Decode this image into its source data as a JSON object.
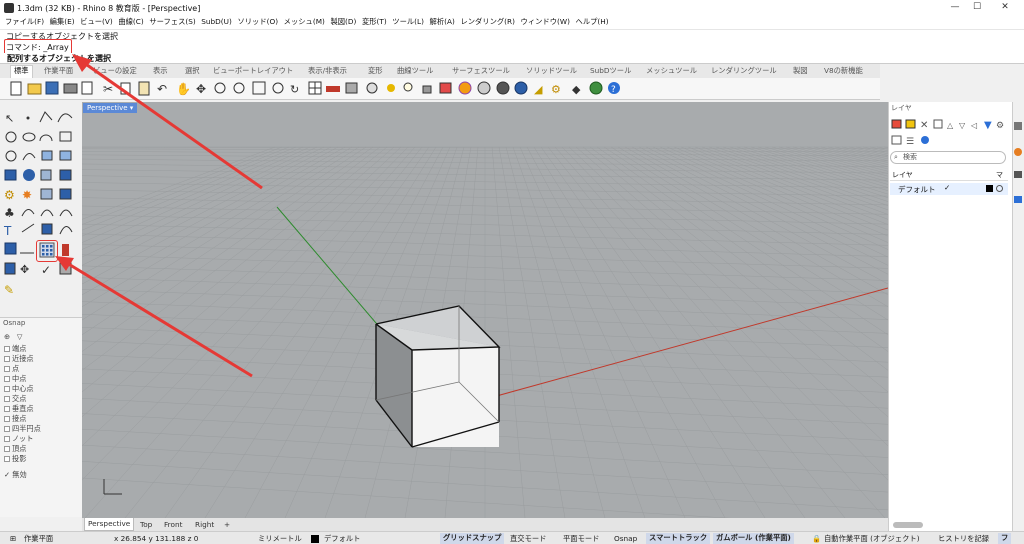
{
  "window": {
    "title": "1.3dm (32 KB) - Rhino 8 教育版 - [Perspective]",
    "min": "—",
    "max": "☐",
    "close": "✕"
  },
  "menu": [
    "ファイル(F)",
    "編集(E)",
    "ビュー(V)",
    "曲線(C)",
    "サーフェス(S)",
    "SubD(U)",
    "ソリッド(O)",
    "メッシュ(M)",
    "製図(D)",
    "変形(T)",
    "ツール(L)",
    "解析(A)",
    "レンダリング(R)",
    "ウィンドウ(W)",
    "ヘルプ(H)"
  ],
  "command": {
    "history": "コピーするオブジェクトを選択",
    "prompt": "コマンド: _Array",
    "status": "配列するオブジェクトを選択"
  },
  "tabs": [
    "標準",
    "作業平面",
    "ビューの設定",
    "表示",
    "選択",
    "ビューポートレイアウト",
    "表示/非表示",
    "変形",
    "曲線ツール",
    "サーフェスツール",
    "ソリッドツール",
    "SubDツール",
    "メッシュツール",
    "レンダリングツール",
    "製図",
    "V8の新機能"
  ],
  "viewport": {
    "label": "Perspective ▾",
    "axis_x_color": "#c0392b",
    "axis_y_color": "#2e8b2e",
    "grid_color": "#9a9d9f"
  },
  "view_tabs": [
    "Perspective",
    "Top",
    "Front",
    "Right",
    "+"
  ],
  "osnap": {
    "title": "Osnap",
    "items": [
      "端点",
      "近接点",
      "点",
      "中点",
      "中心点",
      "交点",
      "垂直点",
      "接点",
      "四半円点",
      "ノット",
      "頂点",
      "投影"
    ],
    "disabled": "✓ 無効"
  },
  "layers": {
    "title": "レイヤ",
    "search_placeholder": "検索",
    "header_name": "レイヤ",
    "header_mat": "マ",
    "default_layer": "デフォルト",
    "check": "✓"
  },
  "status": {
    "cplane": "作業平面",
    "coords": "x 26.854  y 131.188  z 0",
    "units": "ミリメートル",
    "layer": "デフォルト",
    "grid_snap": "グリッドスナップ",
    "ortho": "直交モード",
    "planar": "平面モード",
    "osnap": "Osnap",
    "smart_track": "スマートトラック",
    "gumball": "ガムボール (作業平面)",
    "auto_cplane": "自動作業平面 (オブジェクト)",
    "history": "ヒストリを記録",
    "filter": "フ"
  },
  "annotation_color": "#e53935"
}
